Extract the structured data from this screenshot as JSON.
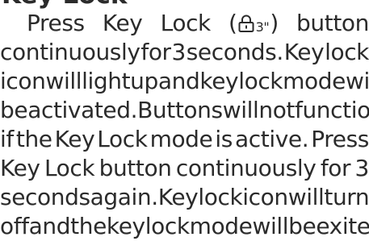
{
  "heading_fragment": "Key Lock",
  "paragraph": {
    "line1": {
      "w1": "Press",
      "w2": "Key",
      "w3": "Lock",
      "paren_open": "(",
      "lock_icon": "lock-icon",
      "lock_subscript": "3\"",
      "paren_close": ")",
      "w4": "button"
    },
    "line2": "continuously for 3 seconds. Key lock",
    "line3": "icon will light up and key lock mode will",
    "line4": "be activated. Buttons will not function",
    "line5": "if the Key Lock mode is active. Press",
    "line6": "Key Lock button continuously for 3",
    "line7": "seconds again. Key lock icon will turn",
    "line8": "off and the key lock mode will be exite."
  },
  "colors": {
    "text": "#2b2b2b",
    "background": "#ffffff"
  }
}
